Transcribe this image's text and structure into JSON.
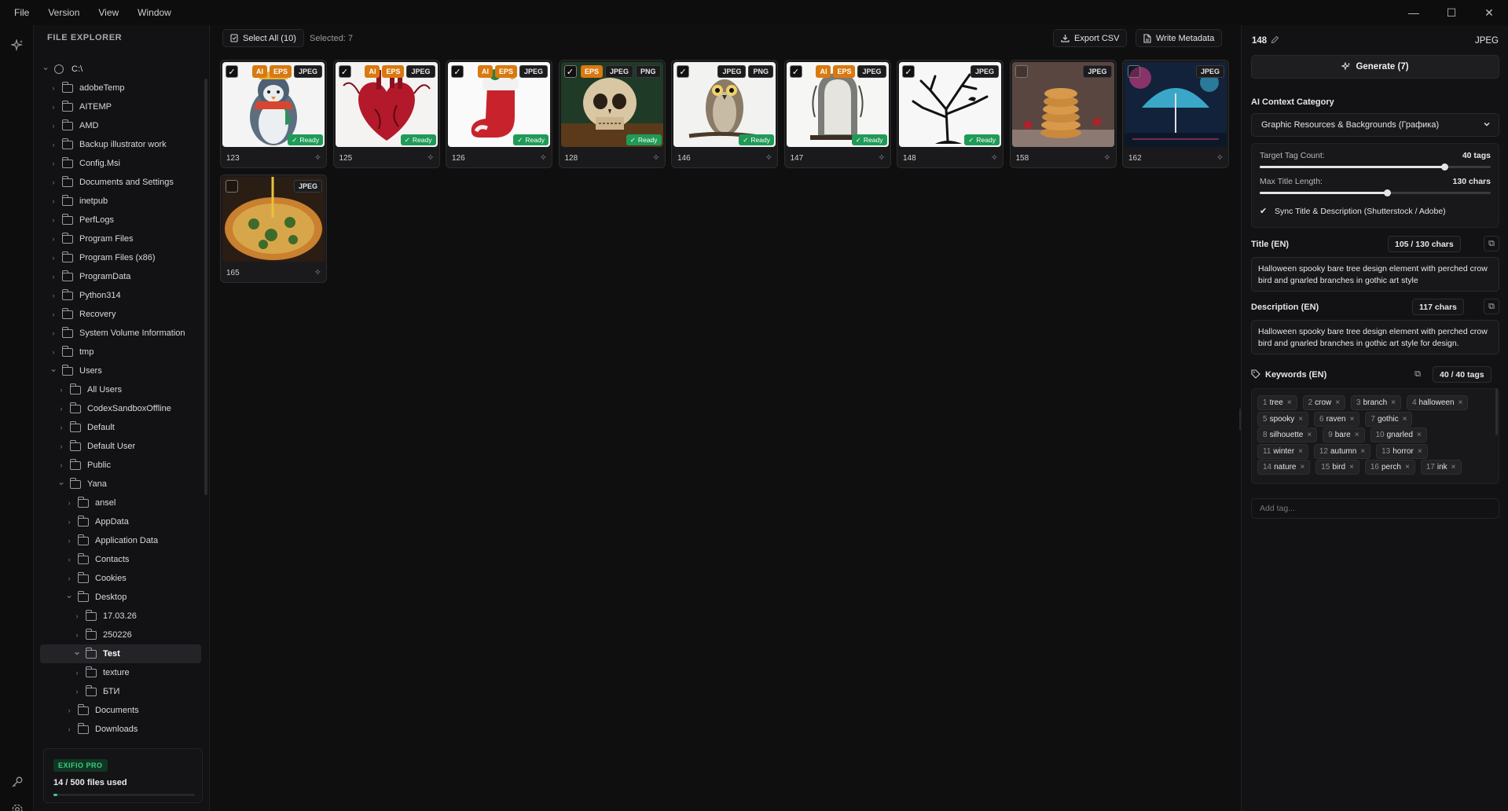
{
  "menu": [
    "File",
    "Version",
    "View",
    "Window"
  ],
  "window_controls": {
    "minimize": "—",
    "maximize": "☐",
    "close": "✕"
  },
  "sidebar": {
    "title": "FILE EXPLORER",
    "tree": [
      {
        "label": "C:\\",
        "depth": 0,
        "type": "drive",
        "expanded": true
      },
      {
        "label": "adobeTemp",
        "depth": 1
      },
      {
        "label": "AITEMP",
        "depth": 1
      },
      {
        "label": "AMD",
        "depth": 1
      },
      {
        "label": "Backup illustrator work",
        "depth": 1
      },
      {
        "label": "Config.Msi",
        "depth": 1
      },
      {
        "label": "Documents and Settings",
        "depth": 1
      },
      {
        "label": "inetpub",
        "depth": 1
      },
      {
        "label": "PerfLogs",
        "depth": 1
      },
      {
        "label": "Program Files",
        "depth": 1
      },
      {
        "label": "Program Files (x86)",
        "depth": 1
      },
      {
        "label": "ProgramData",
        "depth": 1
      },
      {
        "label": "Python314",
        "depth": 1
      },
      {
        "label": "Recovery",
        "depth": 1
      },
      {
        "label": "System Volume Information",
        "depth": 1
      },
      {
        "label": "tmp",
        "depth": 1
      },
      {
        "label": "Users",
        "depth": 1,
        "expanded": true
      },
      {
        "label": "All Users",
        "depth": 2
      },
      {
        "label": "CodexSandboxOffline",
        "depth": 2
      },
      {
        "label": "Default",
        "depth": 2
      },
      {
        "label": "Default User",
        "depth": 2
      },
      {
        "label": "Public",
        "depth": 2
      },
      {
        "label": "Yana",
        "depth": 2,
        "expanded": true
      },
      {
        "label": "ansel",
        "depth": 3
      },
      {
        "label": "AppData",
        "depth": 3
      },
      {
        "label": "Application Data",
        "depth": 3
      },
      {
        "label": "Contacts",
        "depth": 3
      },
      {
        "label": "Cookies",
        "depth": 3
      },
      {
        "label": "Desktop",
        "depth": 3,
        "expanded": true
      },
      {
        "label": "17.03.26",
        "depth": 4
      },
      {
        "label": "250226",
        "depth": 4
      },
      {
        "label": "Test",
        "depth": 4,
        "expanded": true,
        "selected": true
      },
      {
        "label": "texture",
        "depth": 4
      },
      {
        "label": "БТИ",
        "depth": 4
      },
      {
        "label": "Documents",
        "depth": 3
      },
      {
        "label": "Downloads",
        "depth": 3
      }
    ],
    "pro": {
      "badge": "EXIFIO PRO",
      "usage": "14 / 500 files used",
      "used": 14,
      "total": 500
    }
  },
  "toolbar": {
    "select_all": "Select All (10)",
    "selected": "Selected: 7",
    "export_csv": "Export CSV",
    "write_metadata": "Write Metadata"
  },
  "cards": [
    {
      "num": "123",
      "checked": true,
      "tags": [
        "AI",
        "EPS",
        "JPEG"
      ],
      "ready": true,
      "scene": "penguin"
    },
    {
      "num": "125",
      "checked": true,
      "tags": [
        "AI",
        "EPS",
        "JPEG"
      ],
      "ready": true,
      "scene": "heart"
    },
    {
      "num": "126",
      "checked": true,
      "tags": [
        "AI",
        "EPS",
        "JPEG"
      ],
      "ready": true,
      "scene": "stocking"
    },
    {
      "num": "128",
      "checked": true,
      "tags": [
        "EPS",
        "JPEG",
        "PNG"
      ],
      "ready": true,
      "scene": "skull"
    },
    {
      "num": "146",
      "checked": true,
      "tags": [
        "JPEG",
        "PNG"
      ],
      "ready": true,
      "scene": "owl"
    },
    {
      "num": "147",
      "checked": true,
      "tags": [
        "AI",
        "EPS",
        "JPEG"
      ],
      "ready": true,
      "scene": "tombstone"
    },
    {
      "num": "148",
      "checked": true,
      "tags": [
        "JPEG"
      ],
      "ready": true,
      "scene": "tree"
    },
    {
      "num": "158",
      "checked": false,
      "tags": [
        "JPEG"
      ],
      "ready": false,
      "scene": "cookies"
    },
    {
      "num": "162",
      "checked": false,
      "tags": [
        "JPEG"
      ],
      "ready": false,
      "scene": "umbrella"
    },
    {
      "num": "165",
      "checked": false,
      "tags": [
        "JPEG"
      ],
      "ready": false,
      "scene": "pizza"
    }
  ],
  "ready_label": "Ready",
  "panel": {
    "file_id": "148",
    "file_type": "JPEG",
    "generate": "Generate (7)",
    "category_label": "AI Context Category",
    "category_value": "Graphic Resources & Backgrounds (Графика)",
    "target_tag_label": "Target Tag Count:",
    "target_tag_value": "40 tags",
    "target_tag_level": 0.8,
    "max_title_label": "Max Title Length:",
    "max_title_value": "130 chars",
    "max_title_level": 0.55,
    "sync_label": "Sync Title & Description (Shutterstock / Adobe)",
    "title_label": "Title (EN)",
    "title_count": "105 / 130 chars",
    "title_text": "Halloween spooky bare tree design element with perched crow bird and gnarled branches in gothic art style",
    "desc_label": "Description (EN)",
    "desc_count": "117 chars",
    "desc_text": "Halloween spooky bare tree design element with perched crow bird and gnarled branches in gothic art style for design.",
    "keywords_label": "Keywords (EN)",
    "keywords_count": "40 / 40 tags",
    "keywords": [
      {
        "n": "1",
        "w": "tree"
      },
      {
        "n": "2",
        "w": "crow"
      },
      {
        "n": "3",
        "w": "branch"
      },
      {
        "n": "4",
        "w": "halloween"
      },
      {
        "n": "5",
        "w": "spooky"
      },
      {
        "n": "6",
        "w": "raven"
      },
      {
        "n": "7",
        "w": "gothic"
      },
      {
        "n": "8",
        "w": "silhouette"
      },
      {
        "n": "9",
        "w": "bare"
      },
      {
        "n": "10",
        "w": "gnarled"
      },
      {
        "n": "11",
        "w": "winter"
      },
      {
        "n": "12",
        "w": "autumn"
      },
      {
        "n": "13",
        "w": "horror"
      },
      {
        "n": "14",
        "w": "nature"
      },
      {
        "n": "15",
        "w": "bird"
      },
      {
        "n": "16",
        "w": "perch"
      },
      {
        "n": "17",
        "w": "ink"
      }
    ],
    "add_tag_placeholder": "Add tag..."
  }
}
